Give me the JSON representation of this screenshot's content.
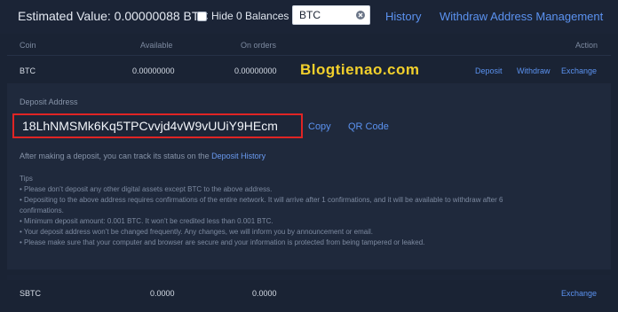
{
  "header": {
    "estimated_value_label": "Estimated Value: 0.00000088 BTC",
    "hide_zero_label": "Hide 0 Balances",
    "search_value": "BTC",
    "history_link": "History",
    "withdraw_mgmt_link": "Withdraw Address Management"
  },
  "table": {
    "columns": [
      "Coin",
      "Available",
      "On orders",
      "Action"
    ],
    "rows": [
      {
        "coin": "BTC",
        "available": "0.00000000",
        "on_orders": "0.00000000",
        "actions": [
          "Deposit",
          "Withdraw",
          "Exchange"
        ]
      },
      {
        "coin": "SBTC",
        "available": "0.0000",
        "on_orders": "0.0000",
        "actions": [
          "Exchange"
        ]
      }
    ]
  },
  "watermark": "Blogtienao.com",
  "deposit": {
    "label": "Deposit Address",
    "address": "18LhNMSMk6Kq5TPCvvjd4vW9vUUiY9HEcm",
    "copy_label": "Copy",
    "qr_label": "QR Code",
    "after_text": "After making a deposit, you can track its status on the ",
    "history_link": "Deposit History",
    "tips_title": "Tips",
    "tips": [
      "• Please don’t deposit any other digital assets except BTC to the above address.",
      "• Depositing to the above address requires confirmations of the entire network. It will arrive after 1 confirmations, and it will be available to withdraw after 6",
      "confirmations.",
      "• Minimum deposit amount: 0.001 BTC. It won’t be credited less than 0.001 BTC.",
      "• Your deposit address won’t be changed frequently. Any changes, we will inform you by announcement or email.",
      "• Please make sure that your computer and browser are secure and your information is protected from being tampered or leaked."
    ]
  },
  "colors": {
    "accent": "#5b92f0",
    "highlight_border": "#e02424",
    "watermark": "#f2d02c",
    "background": "#1a2334"
  }
}
